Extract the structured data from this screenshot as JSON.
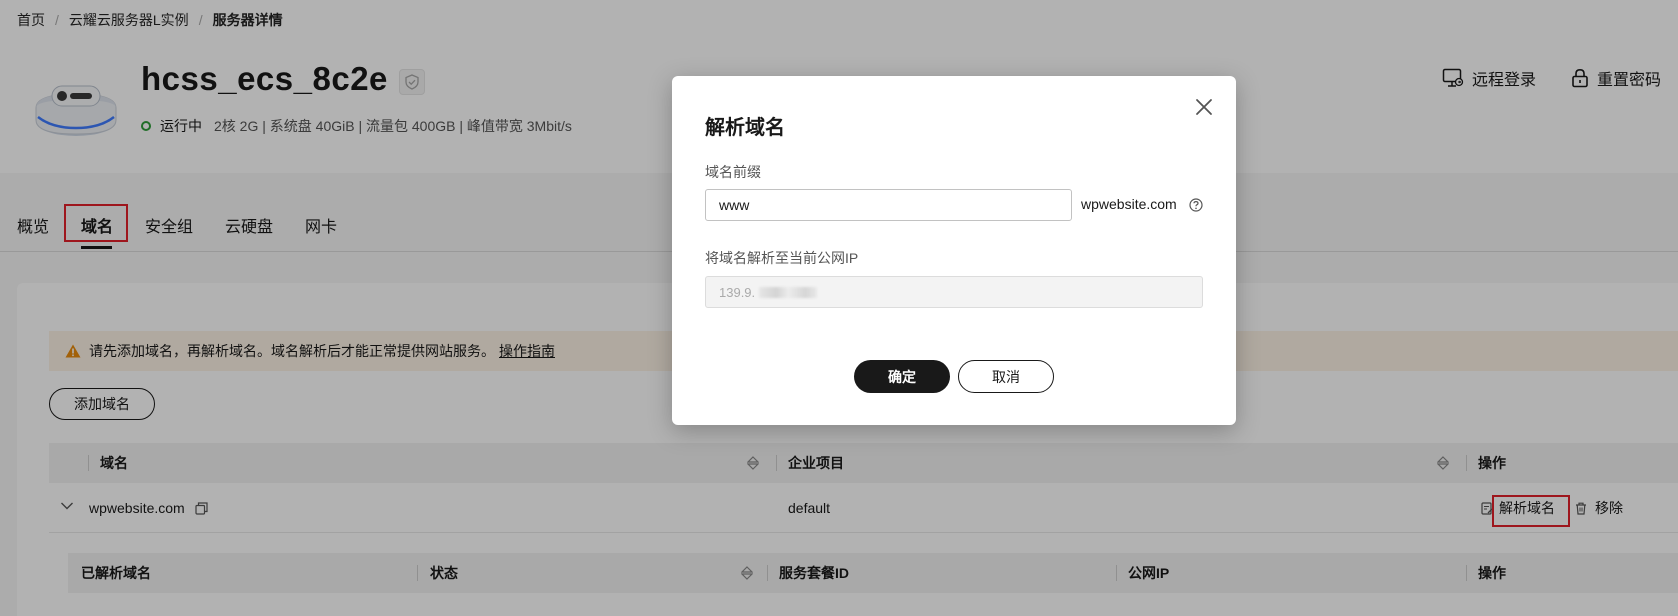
{
  "breadcrumb": {
    "items": [
      "首页",
      "云耀云服务器L实例",
      "服务器详情"
    ],
    "separator": "/"
  },
  "server": {
    "name": "hcss_ecs_8c2e",
    "status": "运行中",
    "specs": "2核  2G | 系统盘 40GiB | 流量包 400GB | 峰值带宽 3Mbit/s"
  },
  "header_actions": {
    "remote_login": "远程登录",
    "reset_password": "重置密码"
  },
  "tabs": [
    {
      "label": "概览"
    },
    {
      "label": "域名"
    },
    {
      "label": "安全组"
    },
    {
      "label": "云硬盘"
    },
    {
      "label": "网卡"
    }
  ],
  "active_tab": "域名",
  "alert": {
    "text": "请先添加域名，再解析域名。域名解析后才能正常提供网站服务。",
    "link": "操作指南"
  },
  "add_domain_button": "添加域名",
  "domain_table": {
    "columns": [
      "域名",
      "企业项目",
      "操作"
    ],
    "rows": [
      {
        "domain": "wpwebsite.com",
        "enterprise_project": "default",
        "actions": [
          "解析域名",
          "移除"
        ]
      }
    ]
  },
  "resolved_table": {
    "columns": [
      "已解析域名",
      "状态",
      "服务套餐ID",
      "公网IP",
      "操作"
    ]
  },
  "modal": {
    "title": "解析域名",
    "prefix_label": "域名前缀",
    "prefix_value": "www",
    "domain_suffix": "wpwebsite.com",
    "ip_label": "将域名解析至当前公网IP",
    "ip_value": "139.9.",
    "confirm": "确定",
    "cancel": "取消"
  },
  "colors": {
    "highlight": "#e3202a",
    "status_green": "#2e9e3a",
    "alert_bg": "#fdf3e6",
    "warning_orange": "#e98b0d"
  }
}
